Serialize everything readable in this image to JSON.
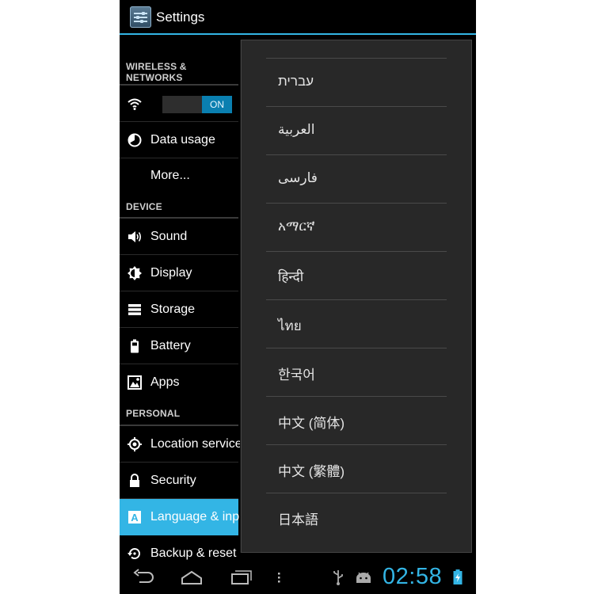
{
  "app": {
    "title": "Settings"
  },
  "sections": {
    "wireless": "WIRELESS & NETWORKS",
    "device": "DEVICE",
    "personal": "PERSONAL"
  },
  "wifi_toggle": {
    "state": "ON"
  },
  "items": {
    "data_usage": "Data usage",
    "more": "More...",
    "sound": "Sound",
    "display": "Display",
    "storage": "Storage",
    "battery": "Battery",
    "apps": "Apps",
    "location": "Location services",
    "security": "Security",
    "language": "Language & input",
    "backup": "Backup & reset"
  },
  "language_dialog": {
    "options": [
      "עברית",
      "العربية",
      "فارسی",
      "አማርኛ",
      "हिन्दी",
      "ไทย",
      "한국어",
      "中文 (简体)",
      "中文 (繁體)",
      "日本語"
    ]
  },
  "status_bar": {
    "time": "02:58"
  },
  "colors": {
    "accent": "#33b5e5",
    "background": "#000000",
    "dialog": "#282828"
  }
}
